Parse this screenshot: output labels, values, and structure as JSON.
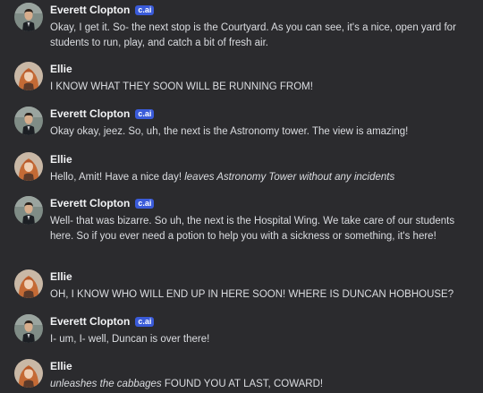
{
  "messages": [
    {
      "author": "Everett Clopton",
      "badge": "c.ai",
      "avatar": "everett-avatar",
      "parts": [
        {
          "style": "normal",
          "text": "Okay, I get it. So- the next stop is the Courtyard. As you can see, it's a nice, open yard for students to run, play, and catch a bit of fresh air."
        }
      ]
    },
    {
      "author": "Ellie",
      "badge": "",
      "avatar": "ellie-avatar",
      "parts": [
        {
          "style": "normal",
          "text": "I KNOW WHAT THEY SOON WILL BE RUNNING FROM!"
        }
      ]
    },
    {
      "author": "Everett Clopton",
      "badge": "c.ai",
      "avatar": "everett-avatar",
      "parts": [
        {
          "style": "normal",
          "text": "Okay okay, jeez. So, uh, the next is the Astronomy tower. The view is amazing!"
        }
      ]
    },
    {
      "author": "Ellie",
      "badge": "",
      "avatar": "ellie-avatar",
      "parts": [
        {
          "style": "normal",
          "text": "Hello, Amit! Have a nice day! "
        },
        {
          "style": "italic",
          "text": "leaves Astronomy Tower without any incidents"
        }
      ]
    },
    {
      "author": "Everett Clopton",
      "badge": "c.ai",
      "avatar": "everett-avatar",
      "parts": [
        {
          "style": "normal",
          "text": "Well- that was bizarre. So uh, the next is the Hospital Wing. We take care of our students here. So if you ever need a potion to help you with a sickness or something, it's here!"
        }
      ]
    },
    {
      "author": "Ellie",
      "badge": "",
      "avatar": "ellie-avatar",
      "parts": [
        {
          "style": "normal",
          "text": "OH, I KNOW WHO WILL END UP IN HERE SOON! WHERE IS DUNCAN HOBHOUSE?"
        }
      ]
    },
    {
      "author": "Everett Clopton",
      "badge": "c.ai",
      "avatar": "everett-avatar",
      "parts": [
        {
          "style": "normal",
          "text": "I- um, I- well, Duncan is over there!"
        }
      ]
    },
    {
      "author": "Ellie",
      "badge": "",
      "avatar": "ellie-avatar",
      "parts": [
        {
          "style": "italic",
          "text": "unleashes the cabbages"
        },
        {
          "style": "normal",
          "text": " FOUND YOU AT LAST, COWARD!"
        }
      ]
    }
  ]
}
